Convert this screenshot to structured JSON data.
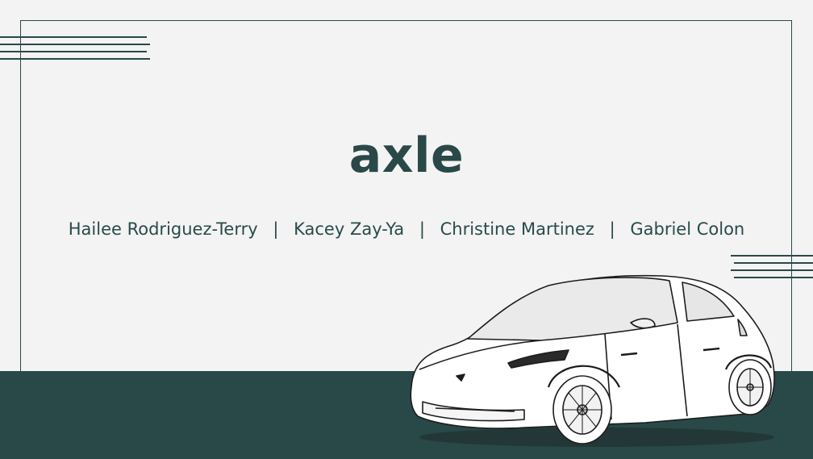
{
  "slide": {
    "title": "axle",
    "authors": [
      "Hailee Rodriguez-Terry",
      "Kacey Zay-Ya",
      "Christine Martinez",
      "Gabriel Colon"
    ],
    "separator": "|",
    "image": {
      "icon": "electric-car-illustration"
    }
  },
  "colors": {
    "background": "#f3f3f3",
    "accent": "#2a4848",
    "band": "#294848",
    "text": "#2a4a4a"
  }
}
